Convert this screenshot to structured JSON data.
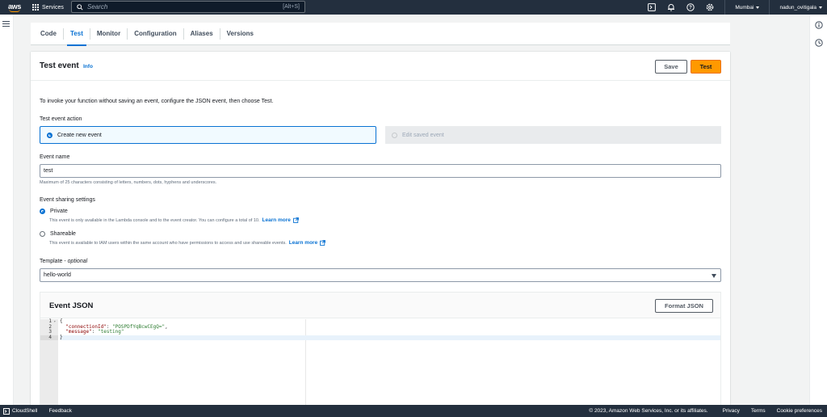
{
  "nav": {
    "logo_text": "aws",
    "services_label": "Services",
    "search_placeholder": "Search",
    "search_shortcut": "[Alt+S]",
    "region": "Mumbai",
    "user": "nadun_ovitigala"
  },
  "tabs": [
    {
      "label": "Code",
      "active": false
    },
    {
      "label": "Test",
      "active": true
    },
    {
      "label": "Monitor",
      "active": false
    },
    {
      "label": "Configuration",
      "active": false
    },
    {
      "label": "Aliases",
      "active": false
    },
    {
      "label": "Versions",
      "active": false
    }
  ],
  "panel": {
    "title": "Test event",
    "info": "Info",
    "save_label": "Save",
    "test_label": "Test",
    "intro": "To invoke your function without saving an event, configure the JSON event, then choose Test.",
    "action_label": "Test event action",
    "action_new": "Create new event",
    "action_saved": "Edit saved event",
    "event_name_label": "Event name",
    "event_name_value": "test",
    "event_name_hint": "Maximum of 25 characters consisting of letters, numbers, dots, hyphens and underscores.",
    "sharing_label": "Event sharing settings",
    "private_label": "Private",
    "private_desc": "This event is only available in the Lambda console and to the event creator. You can configure a total of 10.",
    "shareable_label": "Shareable",
    "shareable_desc": "This event is available to IAM users within the same account who have permissions to access and use shareable events.",
    "learn_more": "Learn more",
    "template_label": "Template",
    "template_optional": "optional",
    "template_value": "hello-world",
    "json_title": "Event JSON",
    "format_label": "Format JSON"
  },
  "editor": {
    "line_numbers": [
      "1",
      "2",
      "3",
      "4"
    ],
    "lines": [
      "{",
      "  \"connectionId\": \"POSPDfYqBcwCEgQ=\",",
      "  \"message\": \"testing\"",
      "}"
    ]
  },
  "footer": {
    "cloudshell": "CloudShell",
    "feedback": "Feedback",
    "copyright": "© 2023, Amazon Web Services, Inc. or its affiliates.",
    "privacy": "Privacy",
    "terms": "Terms",
    "cookies": "Cookie preferences"
  },
  "colors": {
    "nav_bg": "#232f3e",
    "accent": "#0972d3",
    "primary_button": "#ff9900"
  }
}
